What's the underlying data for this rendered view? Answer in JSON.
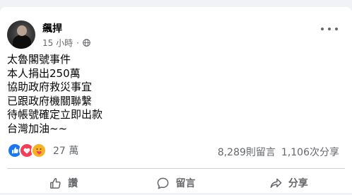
{
  "post": {
    "author": "飆捍",
    "time": "15 小時",
    "separator": "·",
    "privacy_icon": "globe-icon",
    "more_icon": "more-horizontal-icon",
    "lines": [
      "太魯閣號事件",
      "本人捐出250萬",
      "協助政府救災事宜",
      "已跟政府機關聯繫",
      "待帳號確定立即出款",
      "台灣加油~~"
    ]
  },
  "engagement": {
    "reaction_icons": [
      "like-reaction-icon",
      "love-reaction-icon",
      "care-reaction-icon"
    ],
    "reaction_count": "27 萬",
    "comments": "8,289則留言",
    "shares": "1,106次分享"
  },
  "actions": {
    "like_label": "讚",
    "comment_label": "留言",
    "share_label": "分享"
  },
  "colors": {
    "like_blue": "#1877f2",
    "love_red": "#f33e58",
    "care_yellow": "#f7b125",
    "muted_text": "#65676b",
    "page_bg": "#f0f2f5"
  }
}
